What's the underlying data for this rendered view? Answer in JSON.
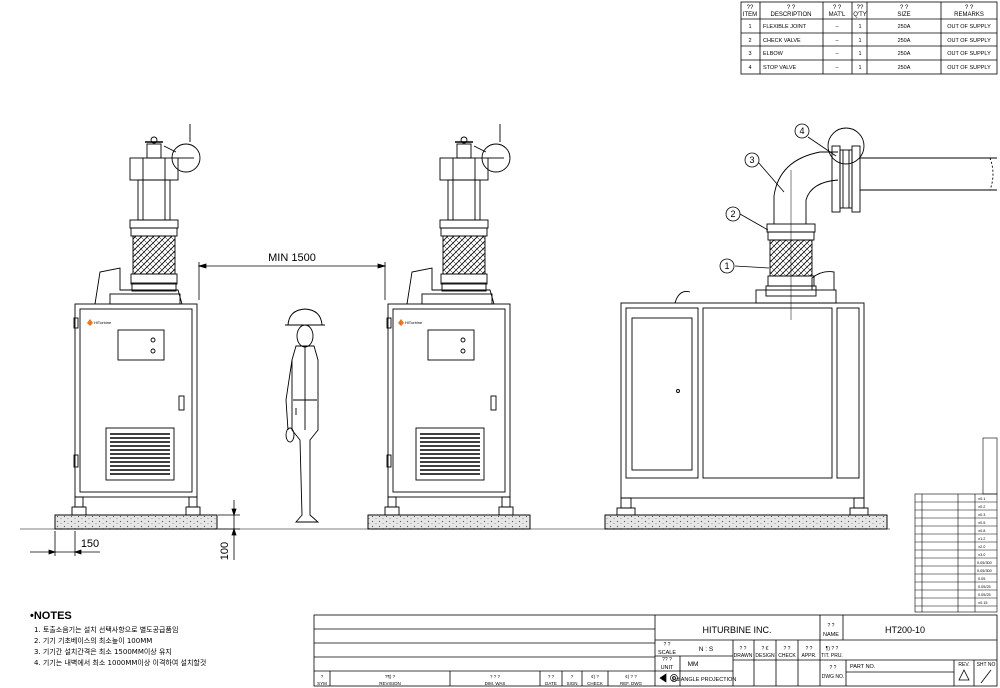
{
  "parts_table": {
    "headers": {
      "item": "ITEM",
      "description": "DESCRIPTION",
      "material": "MAT'L",
      "qty": "Q'TY",
      "size": "SIZE",
      "remarks": "REMARKS"
    },
    "header_marks": {
      "item": "??",
      "description": "?      ?",
      "material": "? ?",
      "qty": "??",
      "size": "?   ?",
      "remarks": "?      ?"
    },
    "rows": [
      {
        "item": "1",
        "description": "FLEXIBLE JOINT",
        "material": "–",
        "qty": "1",
        "size": "250A",
        "remarks": "OUT OF SUPPLY"
      },
      {
        "item": "2",
        "description": "CHECK VALVE",
        "material": "–",
        "qty": "1",
        "size": "250A",
        "remarks": "OUT OF SUPPLY"
      },
      {
        "item": "3",
        "description": "ELBOW",
        "material": "–",
        "qty": "1",
        "size": "250A",
        "remarks": "OUT OF SUPPLY"
      },
      {
        "item": "4",
        "description": "STOP VALVE",
        "material": "–",
        "qty": "1",
        "size": "250A",
        "remarks": "OUT OF SUPPLY"
      }
    ]
  },
  "dimensions": {
    "min_spacing": "MIN 1500",
    "base_offset": "150",
    "base_height": "100"
  },
  "balloons": [
    "1",
    "2",
    "3",
    "4"
  ],
  "brand_badge": "HiTurbine",
  "notes": {
    "title": "•NOTES",
    "items": [
      "1. 토출소음기는 설치 선택사항으로 별도공급품임",
      "2. 기기 기초베이스의 최소높이 100MM",
      "3. 기기간 설치간격은 최소 1500MM이상 유지",
      "4. 기기는 내벽에서 최소 1000MM이상 이격하여 설치할것"
    ]
  },
  "title_block": {
    "company": "HITURBINE INC.",
    "drawing_no": "HT200-10",
    "scale_label": "SCALE",
    "scale_value": "N : S",
    "unit_label": "UNIT",
    "unit_value": "MM",
    "projection": "3rd ANGLE PROJECTION",
    "name_label": "NAME",
    "drawn": "DRAWN",
    "design": "DESIGN",
    "check": "CHECK",
    "appr": "APPR.",
    "tit_pru": "TIT. PRU.",
    "dwg_no": "DWG NO.",
    "part_no": "PART NO.",
    "rev": "REV.",
    "sht_no": "SHT NO",
    "sym": "SYM",
    "revision": "REVISION",
    "dim_was": "DIM.  WAS",
    "date": "DATE",
    "sign": "SIGN",
    "rev_check": "CHECK",
    "ref_dwg": "REF. DWG",
    "marks": {
      "scale": "? ?",
      "unit": "?? ?",
      "name": "? ?",
      "drawn": "? ?",
      "design": "? €",
      "check": "? ?",
      "appr": "? ?",
      "tit": "¶) ? ?",
      "dwg": "? ?",
      "sym": "?",
      "revision": "?¶) ?",
      "dim": "? ? ?",
      "date": "? ?",
      "sign": "?",
      "check2": "¢) ?",
      "ref": "¢) ? ?"
    }
  },
  "tolerance_table": {
    "rows": [
      "±0.1",
      "±0.2",
      "±0.3",
      "±0.5",
      "±0.8",
      "±1.2",
      "±2.0",
      "±3.0",
      "0.05/300",
      "0.05/300",
      "0.05",
      "0.05/25",
      "0.05/25",
      "±0.15"
    ]
  }
}
